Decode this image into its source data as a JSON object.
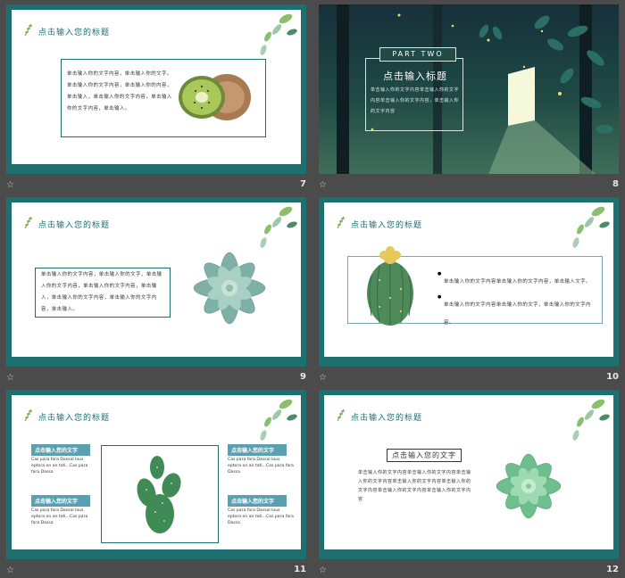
{
  "slides": [
    {
      "number": "7",
      "title": "点击输入您的标题",
      "body": "单击输入你的文字内容，单击输入你的文字。单击输入你的文字内容，单击输入你的内容，单击输入，单击输入你的文字内容，单击输入你的文字内容，单击输入。"
    },
    {
      "number": "8",
      "part_label": "PART TWO",
      "title": "点击输入标题",
      "body": "单击输入你的文字内容单击输入你的文字内容单击输入你的文字内容，单击输入你的文字内容"
    },
    {
      "number": "9",
      "title": "点击输入您的标题",
      "body": "单击输入你的文字内容，单击输入你的文字，单击输入你的文字内容，单击输入你的文字内容，单击输入，单击输入你的文字内容，单击输入你的文字内容，单击输入。"
    },
    {
      "number": "10",
      "title": "点击输入您的标题",
      "bullets": [
        "单击输入你的文字内容单击输入你的文字内容，单击输入文字。",
        "单击输入你的文字内容单击输入你的文字，单击输入你的文字内容。"
      ]
    },
    {
      "number": "11",
      "title": "点击输入您的标题",
      "items": [
        {
          "heading": "点击输入您的文字",
          "text": "Cas para fara Dassal lous eptora on an tati...Cas para fara Dassa"
        },
        {
          "heading": "点击输入您的文字",
          "text": "Cas para fara Dassal lous eptora on an tati...Cas para fara Dassa"
        },
        {
          "heading": "点击输入您的文字",
          "text": "Cas para fara Dassal lous eptora on an tati...Cas para fara Dassa"
        },
        {
          "heading": "点击输入您的文字",
          "text": "Cas para fara Dassal lous eptora on an tati...Cas para fara Dassa"
        }
      ]
    },
    {
      "number": "12",
      "title": "点击输入您的标题",
      "subtitle": "点击输入您的文字",
      "body": "单击输入你的文字内容单击输入你的文字内容单击输入你的文字内容单击输入你的文字内容单击输入你的文字内容单击输入你的文字内容单击输入你的文字内容"
    }
  ],
  "colors": {
    "teal": "#1e6f6f",
    "background": "#4b4b4b",
    "accent": "#5ba0b0"
  },
  "icons": {
    "footer": "star-icon",
    "sprig": "leaf-sprig-icon"
  }
}
